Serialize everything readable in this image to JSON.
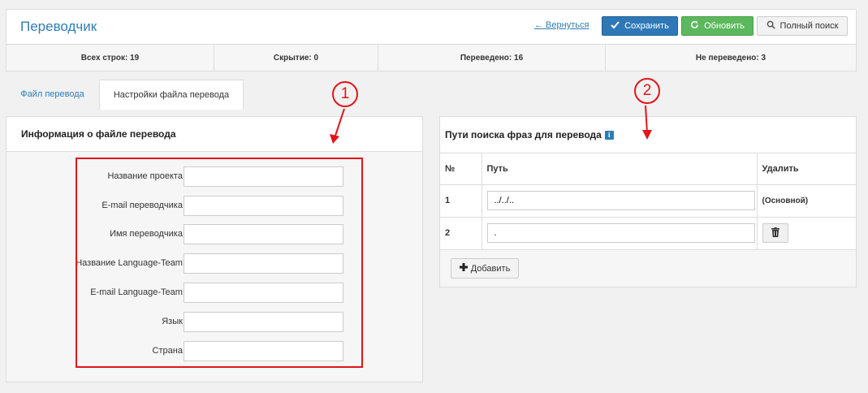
{
  "header": {
    "title": "Переводчик",
    "back_link": "← Вернуться",
    "save_label": "Сохранить",
    "refresh_label": "Обновить",
    "search_label": "Полный поиск"
  },
  "stats": {
    "total": "Всех строк: 19",
    "hidden": "Скрытие: 0",
    "translated": "Переведено: 16",
    "untranslated": "Не переведено: 3"
  },
  "tabs": [
    {
      "label": "Файл перевода",
      "active": false
    },
    {
      "label": "Настройки файла перевода",
      "active": true
    }
  ],
  "file_info": {
    "heading": "Информация о файле перевода",
    "fields": [
      {
        "label": "Название проекта:",
        "value": ""
      },
      {
        "label": "E-mail переводчика:",
        "value": ""
      },
      {
        "label": "Имя переводчика:",
        "value": ""
      },
      {
        "label": "Название Language-Team:",
        "value": ""
      },
      {
        "label": "E-mail Language-Team:",
        "value": ""
      },
      {
        "label": "Язык:",
        "value": ""
      },
      {
        "label": "Страна:",
        "value": ""
      }
    ]
  },
  "search_paths": {
    "heading": "Пути поиска фраз для перевода",
    "columns": [
      "№",
      "Путь",
      "Удалить"
    ],
    "rows": [
      {
        "num": "1",
        "path": "../../..",
        "delete_text": "(Основной)"
      },
      {
        "num": "2",
        "path": ".",
        "delete_text": ""
      }
    ],
    "add_label": "Добавить"
  },
  "annotations": {
    "marker_1": "1",
    "marker_2": "2",
    "color": "#e3141a"
  },
  "colors": {
    "accent": "#2f7db5",
    "save": "#2e78b7",
    "refresh": "#5cb85c"
  }
}
